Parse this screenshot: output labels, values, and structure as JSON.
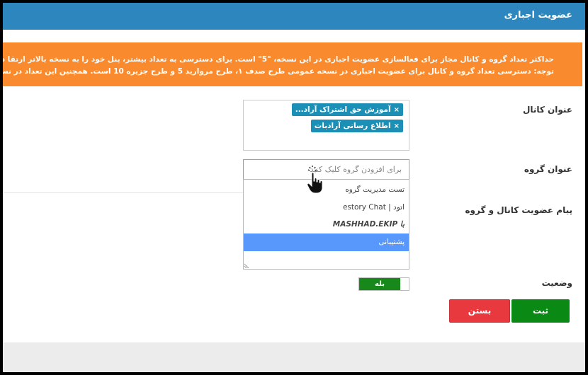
{
  "modal": {
    "title": "عضویت اجباری",
    "alert": {
      "line1": "حداکثر تعداد گروه و کانال مجاز برای فعالسازی عضویت اجباری در این نسخه، \"5\" است. برای دسترسی به تعداد بیشتر، پنل خود را به نسخه بالاتر ارتقا دهید.",
      "line2": "توجه: دسترسی تعداد گروه و کانال برای عضویت اجباری در نسخه عمومی طرح صدف ۱، طرح مروارید 5 و طرح جزیره 10 است. همچنین این تعداد در نسخه های اختصاصی فروشگاه و"
    }
  },
  "form": {
    "channel_label": "عنوان کانال",
    "channel_tags": [
      "آموزش حق اشتراک آراد...",
      "اطلاع رسانی آرادبات"
    ],
    "tag_remove_glyph": "×",
    "group_label": "عنوان گروه",
    "group_placeholder": "برای افزودن گروه کلیک کنید",
    "group_options": [
      "تست مدیریت گروه",
      "اتود | estory Chat",
      "با MASHHAD.EKIP",
      "پشتیبانی"
    ],
    "message_label": "پیام عضویت کانال و گروه",
    "status_label": "وضعیت",
    "status_value": "بله"
  },
  "buttons": {
    "save": "ثبت",
    "close": "بستن"
  },
  "colors": {
    "header": "#2d86bd",
    "alert": "#f98a2e",
    "tag": "#1c8fb6",
    "option_selected": "#5897fb",
    "save": "#0a8a14",
    "close": "#e8393f"
  }
}
